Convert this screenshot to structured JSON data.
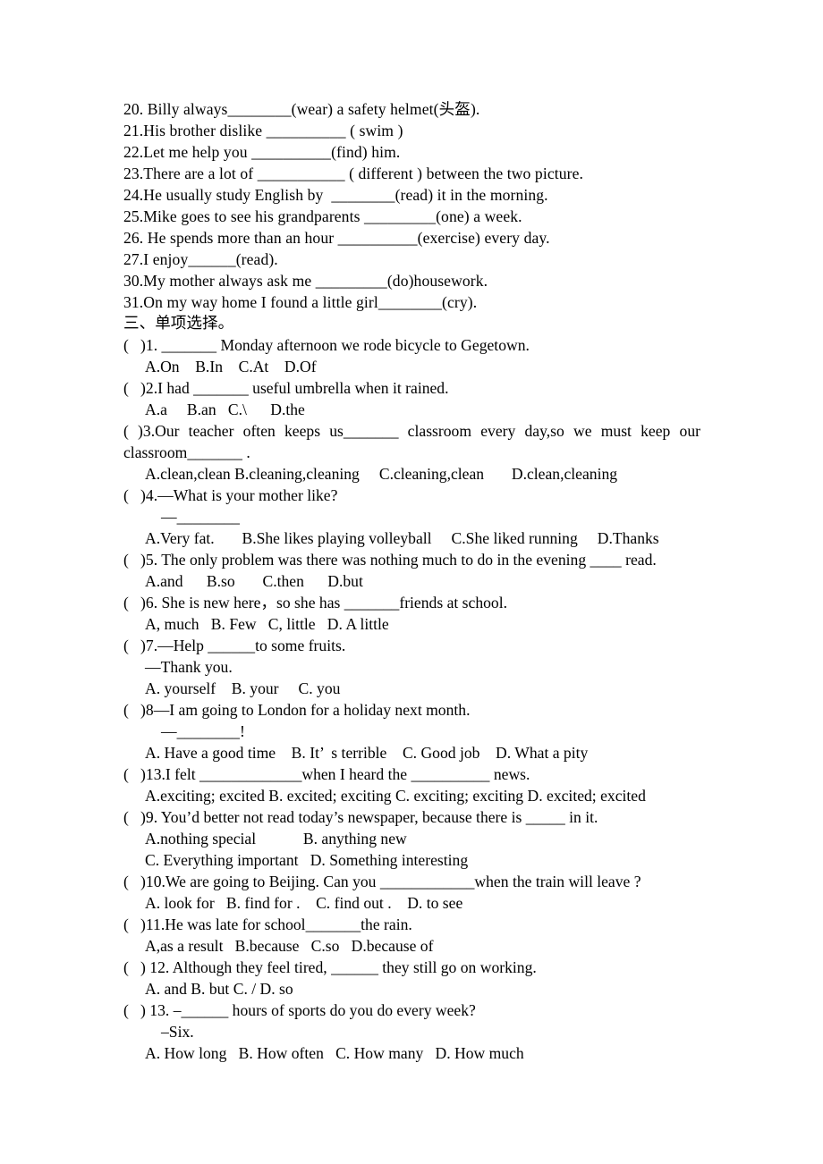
{
  "document": {
    "fill_in_blanks": [
      "20. Billy always________(wear) a safety helmet(头盔).",
      "21.His brother dislike __________ ( swim )",
      "22.Let me help you __________(find) him.",
      "23.There are a lot of ___________ ( different ) between the two picture.",
      "24.He usually study English by  ________(read) it in the morning.",
      "25.Mike goes to see his grandparents _________(one) a week.",
      "26. He spends more than an hour __________(exercise) every day.",
      "27.I enjoy______(read).",
      "30.My mother always ask me _________(do)housework.",
      "31.On my way home I found a little girl________(cry)."
    ],
    "section_heading": "三、单项选择。",
    "questions": [
      {
        "stem": "(   )1. _______ Monday afternoon we rode bicycle to Gegetown.",
        "options": "A.On    B.In    C.At    D.Of"
      },
      {
        "stem": "(   )2.I had _______ useful umbrella when it rained.",
        "options": "A.a     B.an   C.\\      D.the"
      },
      {
        "stem": "(   )3.Our teacher often keeps us_______ classroom every day,so we must keep our classroom_______ .",
        "justify": true,
        "options": "A.clean,clean B.cleaning,cleaning     C.cleaning,clean       D.clean,cleaning"
      },
      {
        "stem": "(   )4.—What is your mother like?",
        "continuation": "—________",
        "options": "A.Very fat.       B.She likes playing volleyball     C.She liked running     D.Thanks"
      },
      {
        "stem": "(   )5. The only problem was there was nothing much to do in the evening ____ read.",
        "options": "A.and      B.so       C.then      D.but"
      },
      {
        "stem": "(   )6. She is new here，so she has _______friends at school.",
        "options": "A, much   B. Few   C, little   D. A little"
      },
      {
        "stem": "(   )7.—Help ______to some fruits.",
        "continuation": "—Thank you.",
        "options": "A. yourself    B. your     C. you"
      },
      {
        "stem": "(   )8—I am going to London for a holiday next month.",
        "continuation": "—________!",
        "options": "A. Have a good time    B. It’  s terrible    C. Good job    D. What a pity"
      },
      {
        "stem": "(   )13.I felt _____________when I heard the __________ news.",
        "options": "A.exciting; excited B. excited; exciting C. exciting; exciting D. excited; excited"
      },
      {
        "stem": "(   )9. You’d better not read today’s newspaper, because there is _____ in it.",
        "options": "A.nothing special            B. anything new",
        "options2": "C. Everything important   D. Something interesting"
      },
      {
        "stem": "(   )10.We are going to Beijing. Can you ____________when the train will leave ?",
        "options": "A. look for   B. find for .    C. find out .    D. to see"
      },
      {
        "stem": "(   )11.He was late for school_______the rain.",
        "options": "A,as a result   B.because   C.so   D.because of"
      },
      {
        "stem": "(   ) 12. Although they feel tired, ______ they still go on working.",
        "options": "A. and B. but C. / D. so"
      },
      {
        "stem": "(   ) 13. –______ hours of sports do you do every week?",
        "continuation": "–Six.",
        "options": "A. How long   B. How often   C. How many   D. How much"
      }
    ]
  }
}
